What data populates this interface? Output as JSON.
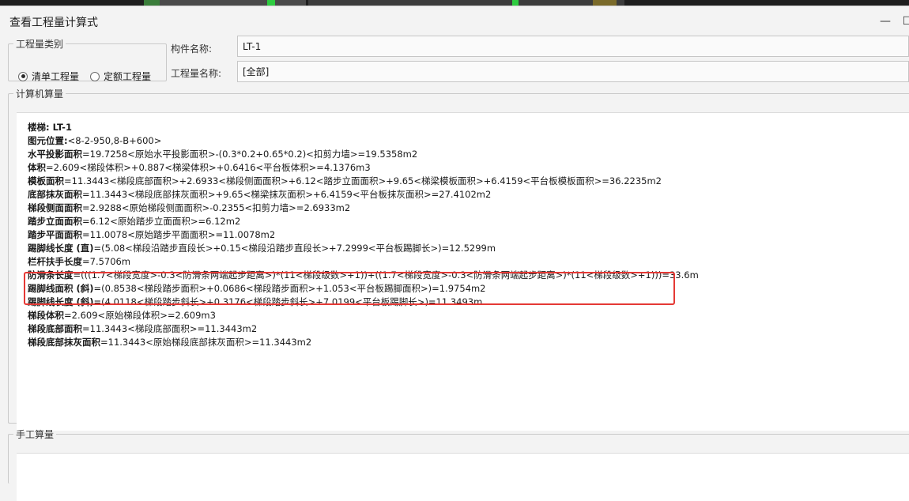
{
  "window": {
    "title": "查看工程量计算式",
    "minimize_glyph": "—",
    "maximize_glyph": "☐"
  },
  "quantity_type": {
    "legend": "工程量类别",
    "options": [
      {
        "label": "清单工程量",
        "selected": true
      },
      {
        "label": "定额工程量",
        "selected": false
      }
    ]
  },
  "component": {
    "name_label": "构件名称:",
    "name_value": "LT-1",
    "qty_label": "工程量名称:",
    "qty_value": "[全部]"
  },
  "computer_calc": {
    "legend": "计算机算量",
    "lines": [
      {
        "key": "楼梯: LT-1",
        "text": ""
      },
      {
        "key": "图元位置:",
        "text": "<8-2-950,8-B+600>"
      },
      {
        "key": "水平投影面积",
        "text": "=19.7258<原始水平投影面积>-(0.3*0.2+0.65*0.2)<扣剪力墙>=19.5358m2"
      },
      {
        "key": "体积",
        "text": "=2.609<梯段体积>+0.887<梯梁体积>+0.6416<平台板体积>=4.1376m3"
      },
      {
        "key": "模板面积",
        "text": "=11.3443<梯段底部面积>+2.6933<梯段侧面面积>+6.12<踏步立面面积>+9.65<梯梁模板面积>+6.4159<平台板模板面积>=36.2235m2"
      },
      {
        "key": "底部抹灰面积",
        "text": "=11.3443<梯段底部抹灰面积>+9.65<梯梁抹灰面积>+6.4159<平台板抹灰面积>=27.4102m2"
      },
      {
        "key": "梯段侧面面积",
        "text": "=2.9288<原始梯段侧面面积>-0.2355<扣剪力墙>=2.6933m2"
      },
      {
        "key": "踏步立面面积",
        "text": "=6.12<原始踏步立面面积>=6.12m2"
      },
      {
        "key": "踏步平面面积",
        "text": "=11.0078<原始踏步平面面积>=11.0078m2"
      },
      {
        "key": "踢脚线长度 (直)",
        "text": "=(5.08<梯段沿踏步直段长>+0.15<梯段沿踏步直段长>+7.2999<平台板踢脚长>)=12.5299m"
      },
      {
        "key": "栏杆扶手长度",
        "text": "=7.5706m"
      },
      {
        "key": "防滑条长度",
        "text": "=(((1.7<梯段宽度>-0.3<防滑条两端起步距离>)*(11<梯段级数>+1))+((1.7<梯段宽度>-0.3<防滑条两端起步距离>)*(11<梯段级数>+1)))=33.6m"
      },
      {
        "key": "踢脚线面积 (斜)",
        "text": "=(0.8538<梯段踏步面积>+0.0686<梯段踏步面积>+1.053<平台板踢脚面积>)=1.9754m2"
      },
      {
        "key": "踢脚线长度 (斜)",
        "text": "=(4.0118<梯段踏步斜长>+0.3176<梯段踏步斜长>+7.0199<平台板踢脚长>)=11.3493m"
      },
      {
        "key": "梯段体积",
        "text": "=2.609<原始梯段体积>=2.609m3"
      },
      {
        "key": "梯段底部面积",
        "text": "=11.3443<梯段底部面积>=11.3443m2"
      },
      {
        "key": "梯段底部抹灰面积",
        "text": "=11.3443<原始梯段底部抹灰面积>=11.3443m2"
      }
    ]
  },
  "manual_calc": {
    "legend": "手工算量"
  },
  "colors": {
    "highlight": "#e53935",
    "top_strip": "#1e1e1e"
  }
}
